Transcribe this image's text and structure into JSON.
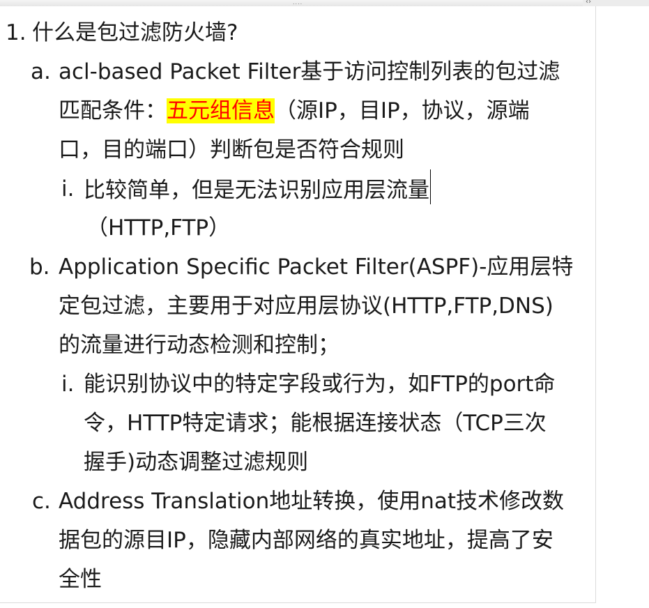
{
  "window": {
    "grip": "....",
    "corner_arrow": "‹›"
  },
  "outline": {
    "item1": {
      "marker": "1.",
      "text": "什么是包过滤防火墙?"
    },
    "item_a": {
      "marker": "a.",
      "line1": "acl-based Packet Filter基于访问控制列表的包过滤",
      "line2_prefix": "匹配条件：",
      "line2_highlight": "五元组信息",
      "line2_suffix": "（源IP，目IP，协议，源端",
      "line3": "口，目的端口）判断包是否符合规则",
      "sub_i": {
        "marker": "i.",
        "line1": "比较简单，但是无法识别应用层流量",
        "line2": "（HTTP,FTP）"
      }
    },
    "item_b": {
      "marker": "b.",
      "line1": "Application Specific Packet Filter(ASPF)-应用层特",
      "line2": "定包过滤，主要用于对应用层协议(HTTP,FTP,DNS)",
      "line3": "的流量进行动态检测和控制；",
      "sub_i": {
        "marker": "i.",
        "line1": "能识别协议中的特定字段或行为，如FTP的port命",
        "line2": "令，HTTP特定请求；能根据连接状态（TCP三次",
        "line3": "握手)动态调整过滤规则"
      }
    },
    "item_c": {
      "marker": "c.",
      "line1": "Address Translation地址转换，使用nat技术修改数",
      "line2": "据包的源目IP，隐藏内部网络的真实地址，提高了安",
      "line3": "全性"
    }
  },
  "colors": {
    "highlight_bg": "#ffff00",
    "highlight_text": "#ff0000",
    "text": "#1a1a1a"
  }
}
